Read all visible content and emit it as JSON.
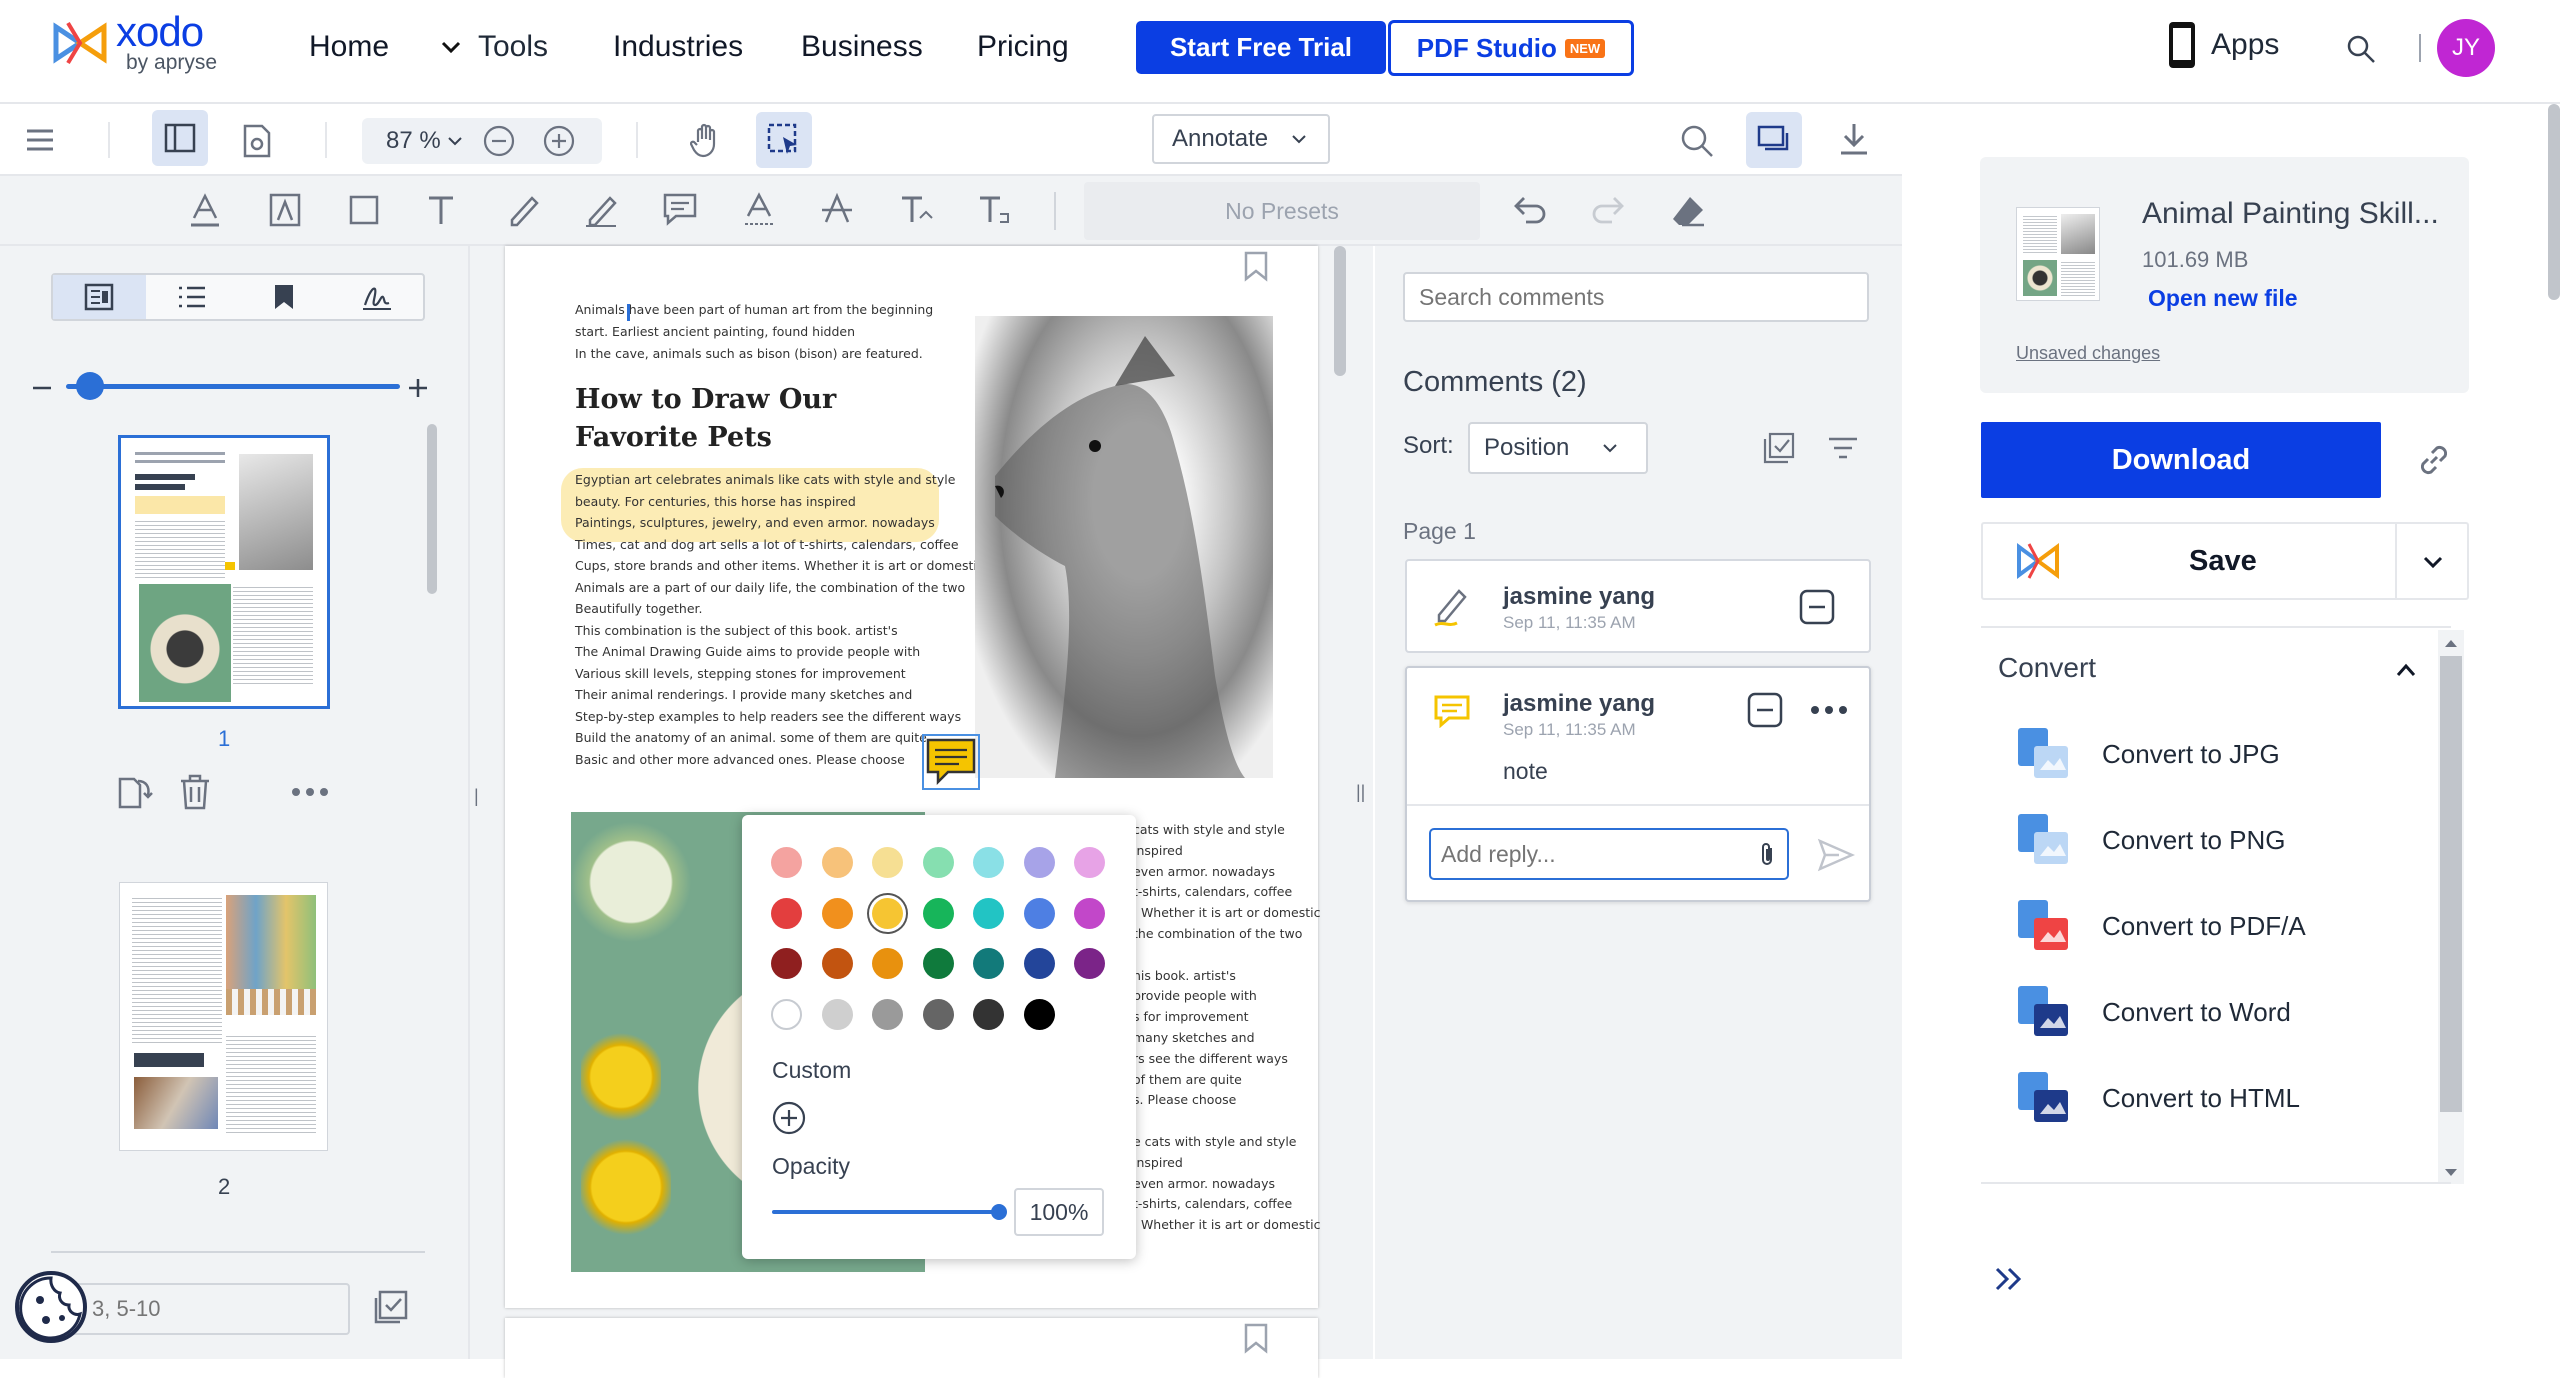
{
  "brand": {
    "name": "xodo",
    "sub": "by apryse"
  },
  "nav": {
    "home": "Home",
    "tools": "Tools",
    "industries": "Industries",
    "business": "Business",
    "pricing": "Pricing",
    "trial": "Start Free Trial",
    "studio": "PDF Studio",
    "studio_badge": "NEW",
    "apps": "Apps",
    "avatar": "JY"
  },
  "toolbar": {
    "zoom": "87 %",
    "mode": "Annotate",
    "presets": "No Presets"
  },
  "thumbs": {
    "page1": "1",
    "page2": "2",
    "page_input_placeholder": "3, 5-10"
  },
  "doc": {
    "intro": [
      "Animals have been part of human art from the beginning",
      "start. Earliest ancient painting, found hidden",
      "In the cave, animals such as bison (bison) are featured."
    ],
    "heading1": "How to Draw Our",
    "heading2": "Favorite Pets",
    "body": [
      "Egyptian art celebrates animals like cats with style and style",
      "beauty. For centuries, this horse has inspired",
      "Paintings, sculptures, jewelry, and even armor. nowadays",
      "Times, cat and dog art sells a lot of t-shirts, calendars, coffee",
      "Cups, store brands and other items. Whether it is art or domestic",
      "Animals are a part of our daily life, the combination of the two",
      "Beautifully together.",
      "This combination is the subject of this book. artist's",
      "The Animal Drawing Guide aims to provide people with",
      "Various skill levels, stepping stones for improvement",
      "Their animal renderings. I provide many sketches and",
      "Step-by-step examples to help readers see the different ways",
      "Build the anatomy of an animal. some of them are quite",
      "Basic and other more advanced ones. Please choose"
    ],
    "right_col": [
      " cats with style and style",
      " inspired",
      "even armor. nowadays",
      "t-shirts, calendars, coffee",
      ". Whether it is art or domestic",
      "the combination of the two",
      "",
      "his book. artist's",
      "provide people with",
      "s for improvement",
      "many sketches and",
      "rs see the different ways",
      "of them are quite",
      "s. Please choose",
      "",
      "e cats with style and style",
      "inspired",
      "even armor. nowadays",
      "t-shirts, calendars, coffee",
      ". Whether it is art or domestic"
    ]
  },
  "picker": {
    "custom": "Custom",
    "opacity": "Opacity",
    "opacity_value": "100%",
    "colors": [
      "#f4a3a0",
      "#f7c27a",
      "#f6df93",
      "#86dfb0",
      "#8ae0e6",
      "#a7a3e8",
      "#e7a3e6",
      "#e33e3e",
      "#f1901d",
      "#f6c532",
      "#17b55a",
      "#22c4c4",
      "#4e7fe3",
      "#c247c9",
      "#8f1f1f",
      "#c25410",
      "#e8910e",
      "#0f7a3c",
      "#127a7a",
      "#23459a",
      "#7b2488",
      "#ffffff",
      "#cfcfcf",
      "#9a9a9a",
      "#656565",
      "#333333",
      "#000000"
    ],
    "selected_index": 9
  },
  "comments": {
    "search_placeholder": "Search comments",
    "title": "Comments (2)",
    "sort_label": "Sort:",
    "sort_value": "Position",
    "page_label": "Page 1",
    "items": [
      {
        "author": "jasmine yang",
        "time": "Sep 11, 11:35 AM"
      },
      {
        "author": "jasmine yang",
        "time": "Sep 11, 11:35 AM",
        "text": "note"
      }
    ],
    "reply_placeholder": "Add reply..."
  },
  "file": {
    "name": "Animal Painting Skill...",
    "size": "101.69 MB",
    "open": "Open new file",
    "unsaved": "Unsaved changes"
  },
  "actions": {
    "download": "Download",
    "save": "Save"
  },
  "convert": {
    "title": "Convert",
    "items": [
      "Convert to JPG",
      "Convert to PNG",
      "Convert to PDF/A",
      "Convert to Word",
      "Convert to HTML"
    ]
  },
  "colors": {
    "accent": "#0b3ee3",
    "avatar": "#c026d3",
    "note": "#f5c400",
    "selection": "#4a90e2"
  }
}
